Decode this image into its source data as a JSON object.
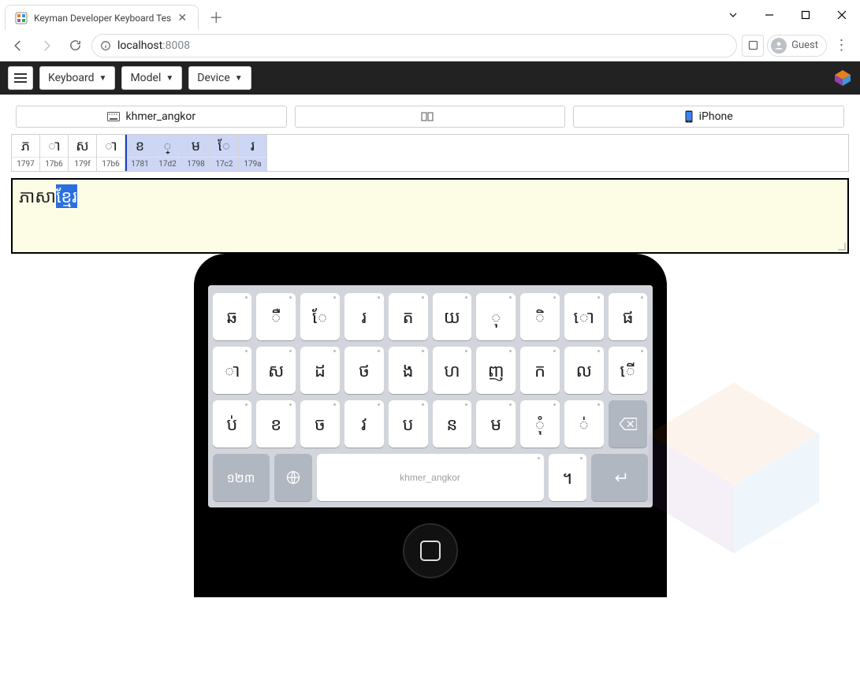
{
  "browser": {
    "tab_title": "Keyman Developer Keyboard Tes",
    "url_host": "localhost",
    "url_port": ":8008",
    "guest_label": "Guest"
  },
  "toolbar": {
    "keyboard_label": "Keyboard",
    "model_label": "Model",
    "device_label": "Device"
  },
  "status": {
    "keyboard_name": "khmer_angkor",
    "model_name": "",
    "device_name": "iPhone"
  },
  "codepoints": [
    {
      "glyph": "ភ",
      "hex": "1797",
      "selected": false
    },
    {
      "glyph": "ា",
      "hex": "17b6",
      "selected": false
    },
    {
      "glyph": "ស",
      "hex": "179f",
      "selected": false
    },
    {
      "glyph": "ា",
      "hex": "17b6",
      "selected": false
    },
    {
      "glyph": "ខ",
      "hex": "1781",
      "selected": true,
      "cursor_before": true
    },
    {
      "glyph": "្",
      "hex": "17d2",
      "selected": true
    },
    {
      "glyph": "ម",
      "hex": "1798",
      "selected": true
    },
    {
      "glyph": "ែ",
      "hex": "17c2",
      "selected": true
    },
    {
      "glyph": "រ",
      "hex": "179a",
      "selected": true
    }
  ],
  "text": {
    "plain": "ភាសា",
    "selected": "ខ្មែរ"
  },
  "keyboard": {
    "rows": [
      [
        "ឆ",
        "ឺ",
        "ែ",
        "រ",
        "ត",
        "យ",
        "ុ",
        "ិ",
        "ោ",
        "ផ"
      ],
      [
        "ា",
        "ស",
        "ដ",
        "ថ",
        "ង",
        "ហ",
        "ញ",
        "ក",
        "ល",
        "ើ"
      ],
      [
        "ប់",
        "ខ",
        "ច",
        "វ",
        "ប",
        "ន",
        "ម",
        "ុំ",
        "់"
      ]
    ],
    "row4": {
      "numbers": "១២៣",
      "space": "khmer_angkor",
      "punct": "។"
    }
  }
}
